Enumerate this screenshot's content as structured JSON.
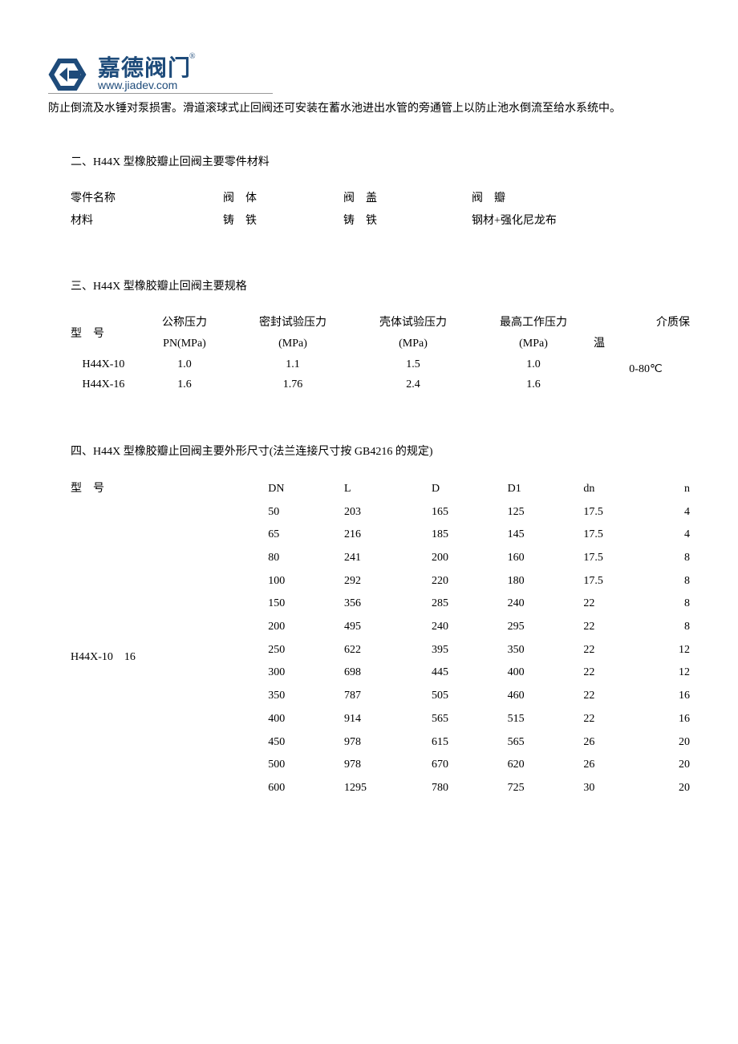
{
  "logo": {
    "brand_cn": "嘉德阀门",
    "brand_en": "www.jiadev.com",
    "reg": "®"
  },
  "intro": "防止倒流及水锤对泵损害。滑道滚球式止回阀还可安装在蓄水池进出水管的旁通管上以防止池水倒流至给水系统中。",
  "section2": {
    "title": "二、H44X 型橡胶瓣止回阀主要零件材料",
    "row_labels": {
      "r0": "零件名称",
      "r1": "材料"
    },
    "cols": {
      "c0_0": "阀　体",
      "c0_1": "阀　盖",
      "c0_2": "阀　瓣",
      "c1_0": "铸　铁",
      "c1_1": "铸　铁",
      "c1_2": "钢材+强化尼龙布"
    }
  },
  "section3": {
    "title": "三、H44X 型橡胶瓣止回阀主要规格",
    "head": {
      "h0a": "型　号",
      "h1a": "公称压力",
      "h1b": "PN(MPa)",
      "h2a": "密封试验压力",
      "h2b": "(MPa)",
      "h3a": "壳体试验压力",
      "h3b": "(MPa)",
      "h4a": "最高工作压力",
      "h4b": "(MPa)",
      "h5a": "介质保",
      "h5b": "温"
    },
    "rows": [
      {
        "m": "H44X-10",
        "pn": "1.0",
        "seal": "1.1",
        "shell": "1.5",
        "max": "1.0"
      },
      {
        "m": "H44X-16",
        "pn": "1.6",
        "seal": "1.76",
        "shell": "2.4",
        "max": "1.6"
      }
    ],
    "temp": "0-80℃"
  },
  "section4": {
    "title": "四、H44X 型橡胶瓣止回阀主要外形尺寸(法兰连接尺寸按 GB4216 的规定)",
    "head": {
      "h0": "型　号",
      "h1": "DN",
      "h2": "L",
      "h3": "D",
      "h4": "D1",
      "h5": "dn",
      "h6": "n"
    },
    "model": "H44X-10　16",
    "rows": [
      {
        "dn": "50",
        "l": "203",
        "d": "165",
        "d1": "125",
        "ddn": "17.5",
        "n": "4"
      },
      {
        "dn": "65",
        "l": "216",
        "d": "185",
        "d1": "145",
        "ddn": "17.5",
        "n": "4"
      },
      {
        "dn": "80",
        "l": "241",
        "d": "200",
        "d1": "160",
        "ddn": "17.5",
        "n": "8"
      },
      {
        "dn": "100",
        "l": "292",
        "d": "220",
        "d1": "180",
        "ddn": "17.5",
        "n": "8"
      },
      {
        "dn": "150",
        "l": "356",
        "d": "285",
        "d1": "240",
        "ddn": "22",
        "n": "8"
      },
      {
        "dn": "200",
        "l": "495",
        "d": "240",
        "d1": "295",
        "ddn": "22",
        "n": "8"
      },
      {
        "dn": "250",
        "l": "622",
        "d": "395",
        "d1": "350",
        "ddn": "22",
        "n": "12"
      },
      {
        "dn": "300",
        "l": "698",
        "d": "445",
        "d1": "400",
        "ddn": "22",
        "n": "12"
      },
      {
        "dn": "350",
        "l": "787",
        "d": "505",
        "d1": "460",
        "ddn": "22",
        "n": "16"
      },
      {
        "dn": "400",
        "l": "914",
        "d": "565",
        "d1": "515",
        "ddn": "22",
        "n": "16"
      },
      {
        "dn": "450",
        "l": "978",
        "d": "615",
        "d1": "565",
        "ddn": "26",
        "n": "20"
      },
      {
        "dn": "500",
        "l": "978",
        "d": "670",
        "d1": "620",
        "ddn": "26",
        "n": "20"
      },
      {
        "dn": "600",
        "l": "1295",
        "d": "780",
        "d1": "725",
        "ddn": "30",
        "n": "20"
      }
    ]
  }
}
